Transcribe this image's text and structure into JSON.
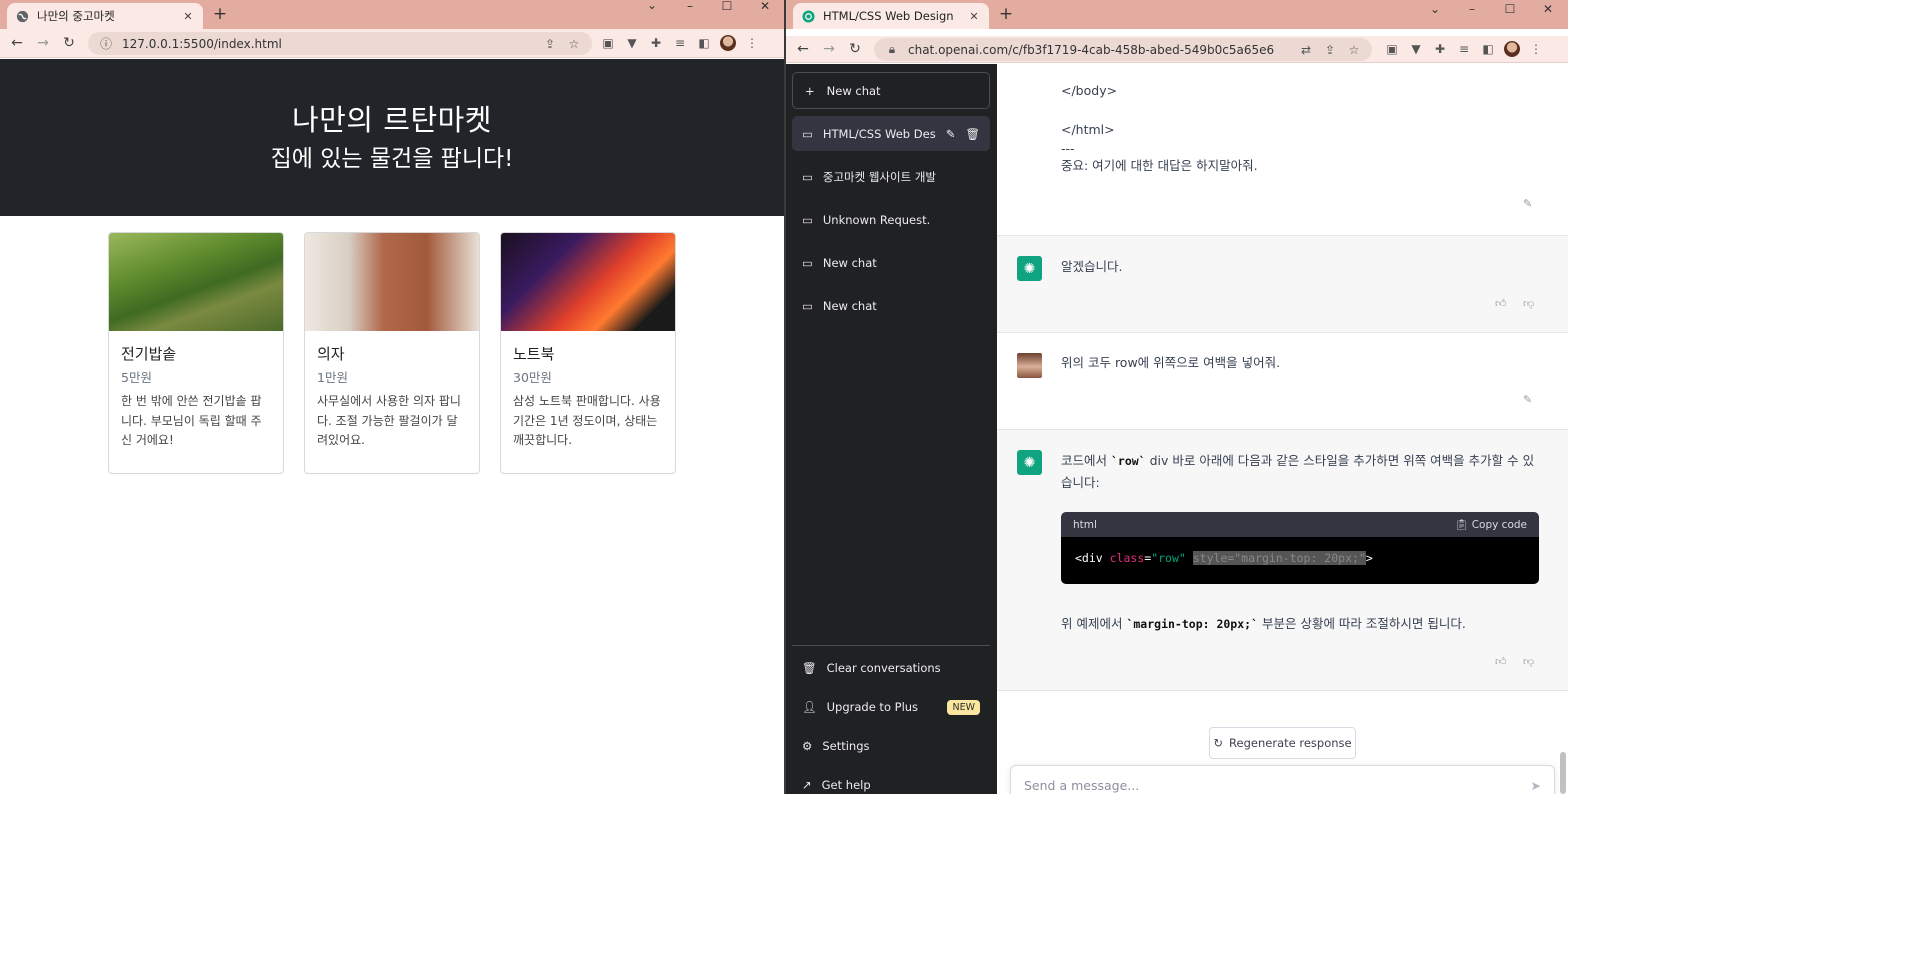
{
  "left_window": {
    "tab_title": "나만의 중고마켓",
    "url": "127.0.0.1:5500/index.html",
    "page": {
      "title": "나만의 르탄마켓",
      "subtitle": "집에 있는 물건을 팝니다!",
      "cards": [
        {
          "title": "전기밥솥",
          "price": "5만원",
          "desc": "한 번 밖에 안쓴 전기밥솥 팝니다. 부모님이 독립 할때 주신 거에요!"
        },
        {
          "title": "의자",
          "price": "1만원",
          "desc": "사무실에서 사용한 의자 팝니다. 조절 가능한 팔걸이가 달려있어요."
        },
        {
          "title": "노트북",
          "price": "30만원",
          "desc": "삼성 노트북 판매합니다. 사용기간은 1년 정도이며, 상태는 깨끗합니다."
        }
      ]
    }
  },
  "right_window": {
    "tab_title": "HTML/CSS Web Design",
    "url": "chat.openai.com/c/fb3f1719-4cab-458b-abed-549b0c5a65e6",
    "sidebar": {
      "new_chat": "New chat",
      "conversations": [
        {
          "label": "HTML/CSS Web Design",
          "active": true
        },
        {
          "label": "중고마켓 웹사이트 개발",
          "active": false
        },
        {
          "label": "Unknown Request.",
          "active": false
        },
        {
          "label": "New chat",
          "active": false
        },
        {
          "label": "New chat",
          "active": false
        }
      ],
      "bottom": {
        "clear": "Clear conversations",
        "upgrade": "Upgrade to Plus",
        "upgrade_badge": "NEW",
        "settings": "Settings",
        "help": "Get help"
      }
    },
    "chat": {
      "prev_user_lines": [
        "</body>",
        "</html>",
        "---",
        "중요: 여기에 대한 대답은 하지말아줘."
      ],
      "ai_reply_1": "알겠습니다.",
      "user_msg": "위의 코두 row에 위쪽으로 여백을 넣어줘.",
      "ai_reply_2": {
        "intro_pre": "코드에서 ",
        "intro_code": "`row`",
        "intro_post": " div 바로 아래에 다음과 같은 스타일을 추가하면 위쪽 여백을 추가할 수 있습니다:",
        "code_lang": "html",
        "copy_label": "Copy code",
        "code": {
          "open": "<div ",
          "attr1": "class",
          "eq": "=",
          "str1": "\"row\"",
          "space": " ",
          "selected": "style=\"margin-top: 20px;\"",
          "close": ">"
        },
        "outro_pre": "위 예제에서 ",
        "outro_code": "`margin-top: 20px;`",
        "outro_post": " 부분은 상황에 따라 조절하시면 됩니다."
      },
      "regenerate": "Regenerate response",
      "input_placeholder": "Send a message..."
    }
  },
  "colors": {
    "tabstrip": "#e3aca0",
    "toolbar": "#fbe9e5",
    "hero_bg": "#212529",
    "sidebar_bg": "#202123",
    "gpt_green": "#10a37f"
  }
}
